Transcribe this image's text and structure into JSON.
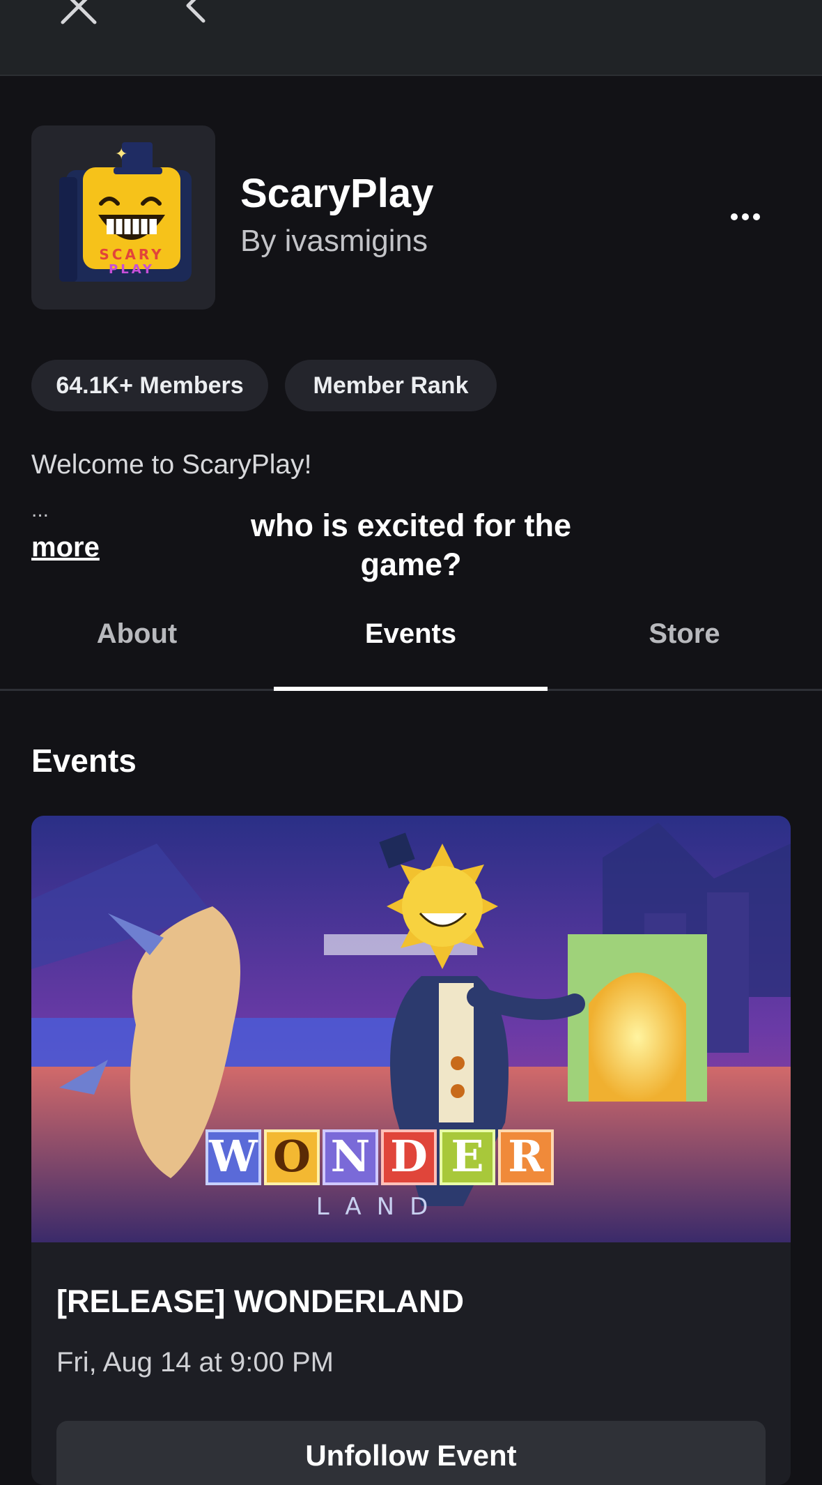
{
  "header": {
    "close_icon": "close-icon",
    "back_icon": "chevron-left-icon"
  },
  "group": {
    "name": "ScaryPlay",
    "owner": "By ivasmigins",
    "icon_text_top": "SCARY",
    "icon_text_bottom": "PLAY",
    "members_chip": "64.1K+ Members",
    "rank_chip": "Member Rank",
    "description": "Welcome to ScaryPlay!",
    "ellipsis": "...",
    "more_link": "more"
  },
  "overlay_caption": "who is excited for the game?",
  "tabs": [
    {
      "label": "About"
    },
    {
      "label": "Events"
    },
    {
      "label": "Store"
    }
  ],
  "events_section": {
    "title": "Events",
    "cards": [
      {
        "image_logo_letters": [
          "W",
          "O",
          "N",
          "D",
          "E",
          "R"
        ],
        "image_logo_sub": "LAND",
        "title": "[RELEASE] WONDERLAND",
        "date": "Fri, Aug 14 at 9:00 PM",
        "button_label": "Unfollow Event"
      }
    ]
  },
  "colors": {
    "background": "#121216",
    "topbar": "#202326",
    "chip": "#24252c",
    "card": "#1d1e24",
    "button": "#2f3137"
  }
}
